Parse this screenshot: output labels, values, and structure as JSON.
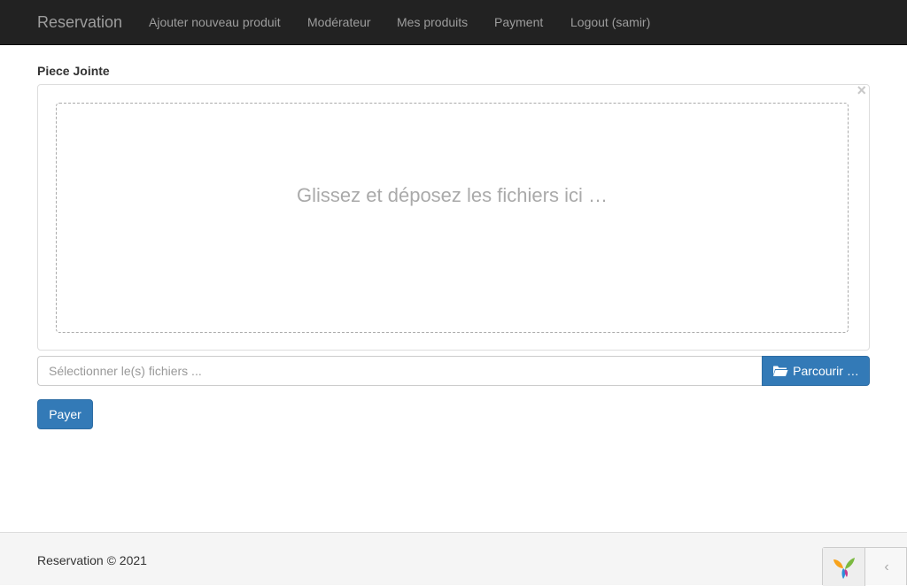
{
  "navbar": {
    "brand": "Reservation",
    "items": [
      {
        "label": "Ajouter nouveau produit"
      },
      {
        "label": "Modérateur"
      },
      {
        "label": "Mes produits"
      },
      {
        "label": "Payment"
      },
      {
        "label": "Logout (samir)"
      }
    ]
  },
  "form": {
    "field_label": "Piece Jointe",
    "close_symbol": "×",
    "drop_text": "Glissez et déposez les fichiers ici …",
    "caption_placeholder": "Sélectionner le(s) fichiers ...",
    "browse_label": "Parcourir …",
    "browse_icon": "folder-open-icon",
    "submit_label": "Payer"
  },
  "footer": {
    "text": "Reservation © 2021",
    "debug_toggle_symbol": "‹"
  },
  "colors": {
    "navbar_bg": "#222222",
    "primary": "#337ab7",
    "footer_bg": "#f5f5f5"
  }
}
